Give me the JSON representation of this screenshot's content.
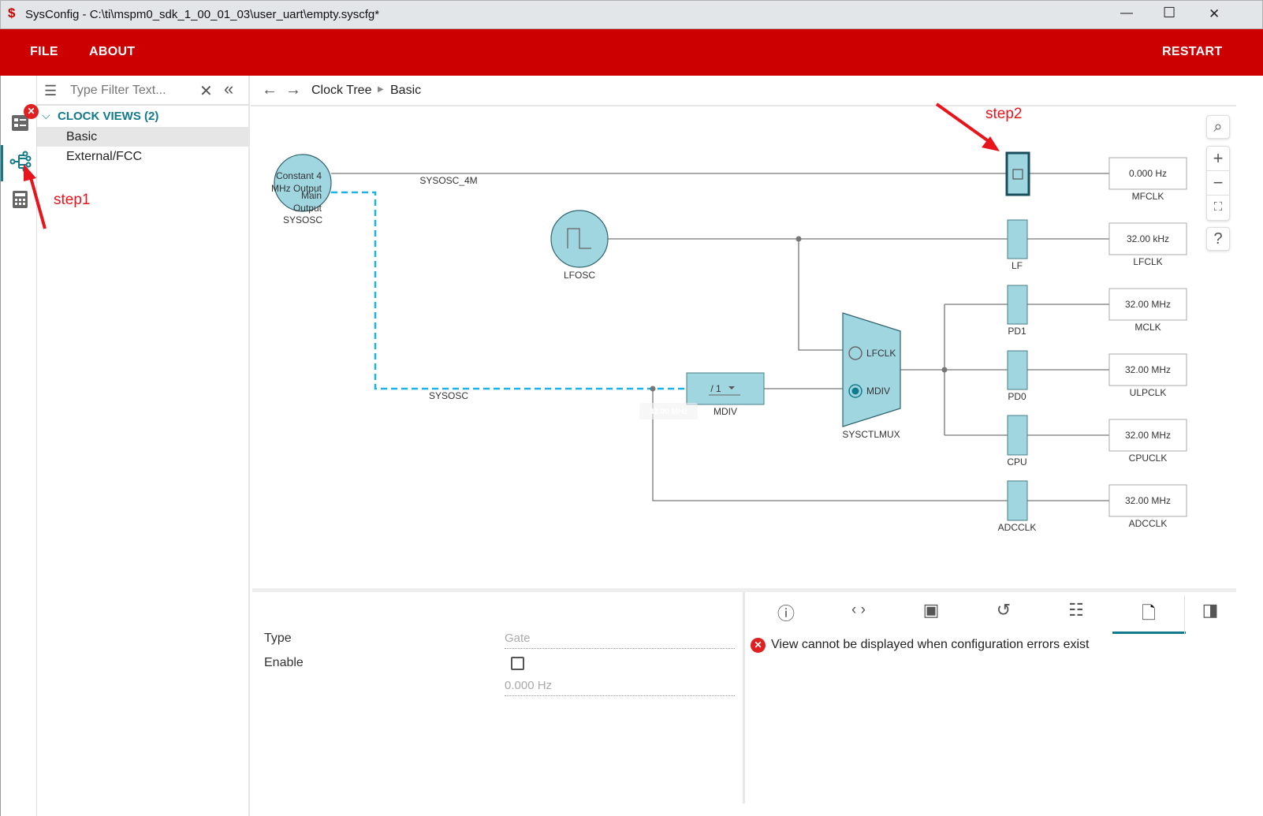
{
  "window": {
    "title": "SysConfig - C:\\ti\\mspm0_sdk_1_00_01_03\\user_uart\\empty.syscfg*",
    "minimize": "—",
    "maximize": "☐",
    "close": "✕"
  },
  "menu": {
    "file": "FILE",
    "about": "ABOUT",
    "restart": "RESTART"
  },
  "brand_color": "#cc0000",
  "accent_color": "#117a8b",
  "nav": {
    "filter_placeholder": "Type Filter Text...",
    "group": "CLOCK VIEWS (2)",
    "items": [
      {
        "label": "Basic",
        "selected": true
      },
      {
        "label": "External/FCC",
        "selected": false
      }
    ]
  },
  "rail": {
    "icons": [
      "module-list-icon",
      "clock-tree-icon",
      "calculator-icon"
    ],
    "error_badge": "✕"
  },
  "breadcrumb": {
    "items": [
      "Clock Tree",
      "Basic"
    ]
  },
  "diagram": {
    "sysosc": {
      "label": "SYSOSC",
      "line1": "Constant 4",
      "line2": "MHz Output",
      "line3": "Main",
      "line4": "Output"
    },
    "sysosc_4m": "SYSOSC_4M",
    "sysosc_net": "SYSOSC",
    "lfosc": "LFOSC",
    "mdiv": {
      "label": "MDIV",
      "value": "/ 1",
      "tooltip": "32.00 MHz"
    },
    "mux": {
      "label": "SYSCTLMUX",
      "options": [
        {
          "label": "LFCLK",
          "selected": false
        },
        {
          "label": "MDIV",
          "selected": true
        }
      ]
    },
    "gates": [
      {
        "label": "",
        "enabled": false,
        "selected": true
      },
      {
        "label": "LF"
      },
      {
        "label": "PD1"
      },
      {
        "label": "PD0"
      },
      {
        "label": "CPU"
      },
      {
        "label": "ADCCLK"
      }
    ],
    "outputs": [
      {
        "value": "0.000 Hz",
        "label": "MFCLK"
      },
      {
        "value": "32.00 kHz",
        "label": "LFCLK"
      },
      {
        "value": "32.00 MHz",
        "label": "MCLK"
      },
      {
        "value": "32.00 MHz",
        "label": "ULPCLK"
      },
      {
        "value": "32.00 MHz",
        "label": "CPUCLK"
      },
      {
        "value": "32.00 MHz",
        "label": "ADCCLK"
      }
    ]
  },
  "annotations": {
    "step1": "step1",
    "step2": "step2"
  },
  "properties": {
    "type_label": "Type",
    "type_value": "Gate",
    "enable_label": "Enable",
    "enable_checked": false,
    "freq_value": "0.000 Hz"
  },
  "right_panel": {
    "message": "View cannot be displayed when configuration errors exist",
    "active_tab": "file-icon"
  }
}
